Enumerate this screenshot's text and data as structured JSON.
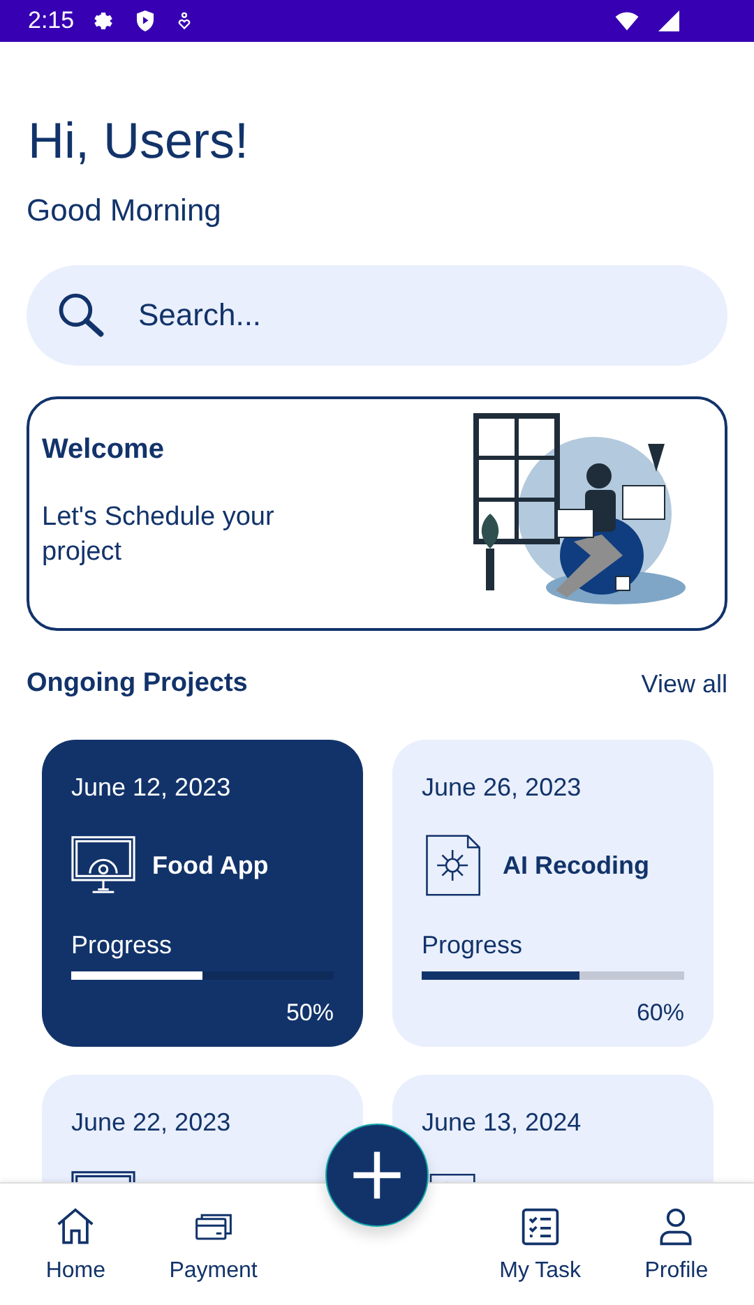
{
  "status_bar": {
    "time": "2:15"
  },
  "greeting": {
    "title": "Hi, Users!",
    "subtitle": "Good Morning"
  },
  "search": {
    "placeholder": "Search..."
  },
  "welcome_card": {
    "title": "Welcome",
    "text": "Let's Schedule your project"
  },
  "section": {
    "title": "Ongoing Projects",
    "link": "View all"
  },
  "projects": [
    {
      "date": "June 12, 2023",
      "name": "Food App",
      "kind": "monitor",
      "selected": true,
      "label": "Progress",
      "level": 0.5,
      "percent": "50%"
    },
    {
      "date": "June 26, 2023",
      "name": "AI Recoding",
      "kind": "document",
      "selected": false,
      "label": "Progress",
      "level": 0.6,
      "percent": "60%"
    },
    {
      "date": "June 22, 2023",
      "kind": "monitor",
      "selected": false
    },
    {
      "date": "June 13, 2024",
      "kind": "checklist",
      "selected": false
    }
  ],
  "bottom_nav": [
    {
      "label": "Home",
      "kind": "home",
      "selected": false
    },
    {
      "label": "Payment",
      "kind": "cards",
      "selected": false
    },
    {
      "kind": "spacer"
    },
    {
      "label": "My Task",
      "kind": "tasks",
      "selected": false
    },
    {
      "label": "Profile",
      "kind": "person",
      "selected": false
    }
  ]
}
